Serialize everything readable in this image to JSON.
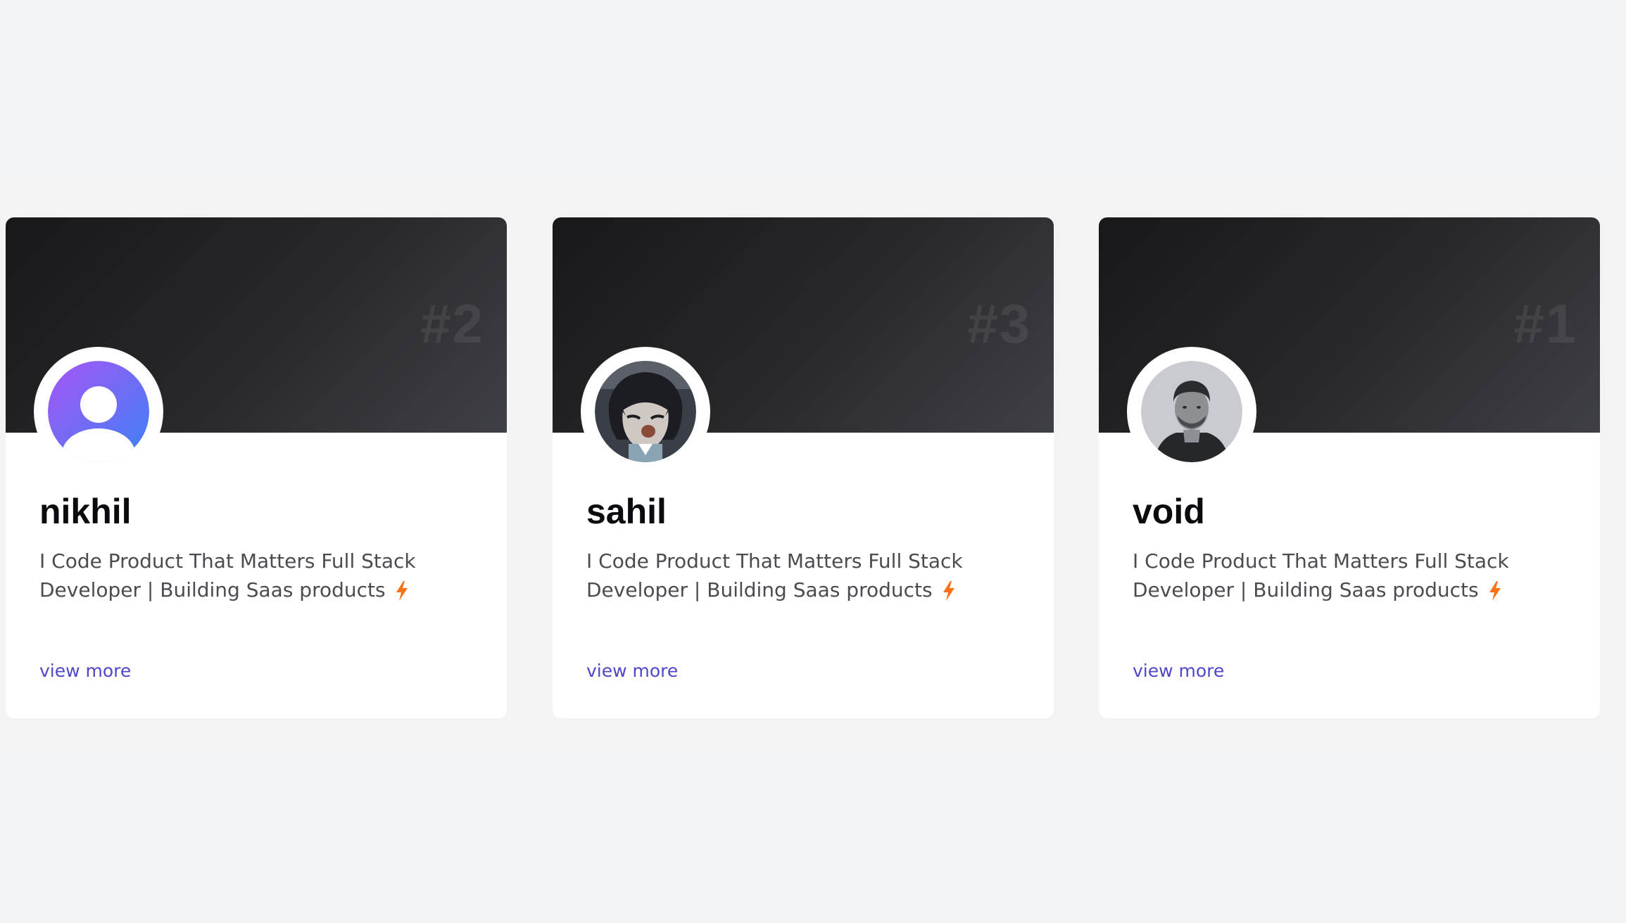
{
  "cards": [
    {
      "rank": "#2",
      "name": "nikhil",
      "bio": "I Code Product That Matters Full Stack Developer | Building Saas products",
      "bio_icon": "lightning-icon",
      "link": "view more",
      "avatar": "default-user-avatar"
    },
    {
      "rank": "#3",
      "name": "sahil",
      "bio": "I Code Product That Matters Full Stack Developer | Building Saas products",
      "bio_icon": "lightning-icon",
      "link": "view more",
      "avatar": "anime-character-avatar"
    },
    {
      "rank": "#1",
      "name": "void",
      "bio": "I Code Product That Matters Full Stack Developer | Building Saas products",
      "bio_icon": "lightning-icon",
      "link": "view more",
      "avatar": "person-photo-avatar"
    }
  ],
  "colors": {
    "page_background": "#f1f3f6",
    "card_background": "#ffffff",
    "banner_dark": "#18181b",
    "link": "#4f46c8",
    "bolt": "#f97316",
    "avatar_gradient_start": "#a855f7",
    "avatar_gradient_end": "#3b82f6"
  }
}
